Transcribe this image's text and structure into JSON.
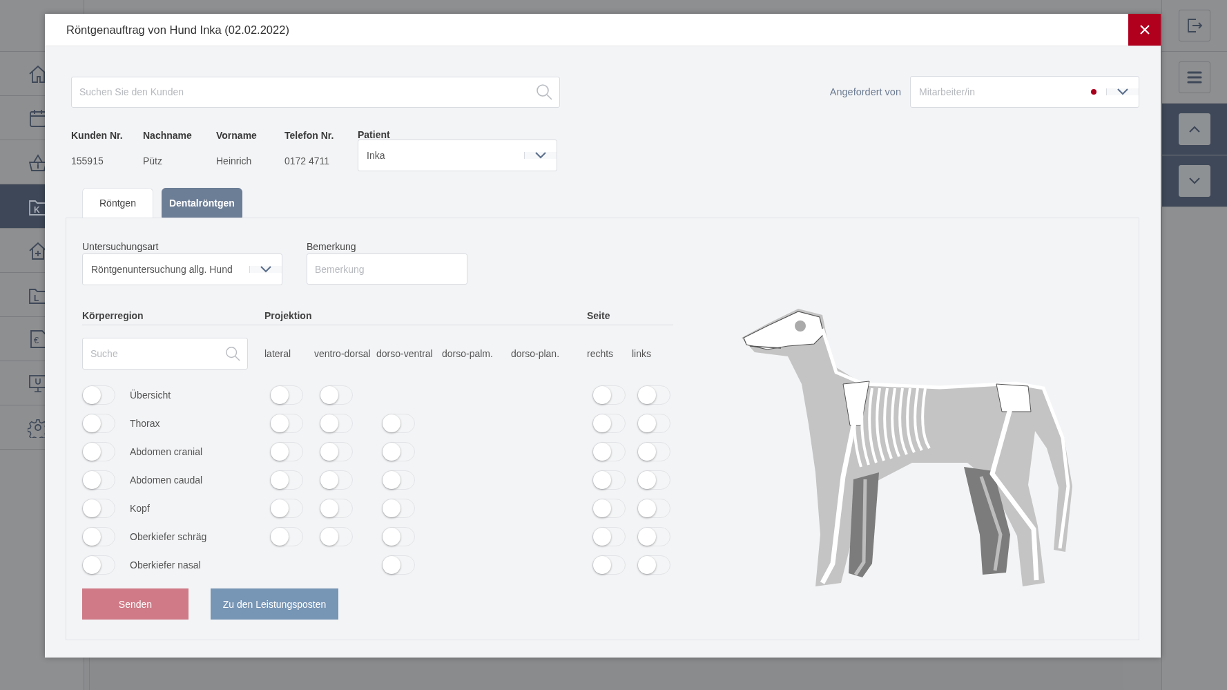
{
  "sidebar": {
    "items": [
      {
        "kind": "home",
        "selected": false
      },
      {
        "kind": "calendar",
        "selected": false
      },
      {
        "kind": "basket",
        "selected": false
      },
      {
        "kind": "folder",
        "letter": "K",
        "selected": true
      },
      {
        "kind": "house-plus",
        "selected": false
      },
      {
        "kind": "folder",
        "letter": "L",
        "selected": false
      },
      {
        "kind": "document",
        "letter": "€",
        "selected": false
      },
      {
        "kind": "monitor",
        "selected": false
      },
      {
        "kind": "gear",
        "selected": false
      }
    ]
  },
  "dialog": {
    "title": "Röntgenauftrag von Hund Inka (02.02.2022)",
    "customer_search": {
      "placeholder": "Suchen Sie den Kunden"
    },
    "requested_by": {
      "label": "Angefordert von",
      "placeholder": "Mitarbeiter/in",
      "required": true
    },
    "customer": [
      {
        "label": "Kunden Nr.",
        "value": "155915"
      },
      {
        "label": "Nachname",
        "value": "Pütz"
      },
      {
        "label": "Vorname",
        "value": "Heinrich"
      },
      {
        "label": "Telefon Nr.",
        "value": "0172 4711"
      }
    ],
    "patient": {
      "label": "Patient",
      "value": "Inka"
    },
    "tabs": [
      {
        "label": "Röntgen",
        "selected": true
      },
      {
        "label": "Dentalröntgen",
        "selected": false
      }
    ],
    "exam_type": {
      "label": "Untersuchungsart",
      "value": "Röntgenuntersuchung allg. Hund"
    },
    "remark": {
      "label": "Bemerkung",
      "placeholder": "Bemerkung"
    },
    "body_regions": {
      "region_header": "Körperregion",
      "projection_header": "Projektion",
      "side_header": "Seite",
      "search_placeholder": "Suche",
      "columns": [
        "lateral",
        "ventro-dorsal",
        "dorso-ventral",
        "dorso-palm.",
        "dorso-plan.",
        "rechts",
        "links"
      ],
      "rows": [
        {
          "label": "Übersicht",
          "on": false,
          "toggles": [
            {
              "kind": "switch",
              "on": false
            },
            {
              "kind": "switch",
              "on": false
            },
            {
              "kind": "empty"
            },
            {
              "kind": "empty"
            },
            {
              "kind": "empty"
            },
            {
              "kind": "switch",
              "on": false
            },
            {
              "kind": "switch",
              "on": false
            }
          ]
        },
        {
          "label": "Thorax",
          "on": false,
          "toggles": [
            {
              "kind": "switch",
              "on": false
            },
            {
              "kind": "switch",
              "on": false
            },
            {
              "kind": "switch",
              "on": false
            },
            {
              "kind": "empty"
            },
            {
              "kind": "empty"
            },
            {
              "kind": "switch",
              "on": false
            },
            {
              "kind": "switch",
              "on": false
            }
          ]
        },
        {
          "label": "Abdomen cranial",
          "on": false,
          "toggles": [
            {
              "kind": "switch",
              "on": false
            },
            {
              "kind": "switch",
              "on": false
            },
            {
              "kind": "switch",
              "on": false
            },
            {
              "kind": "empty"
            },
            {
              "kind": "empty"
            },
            {
              "kind": "switch",
              "on": false
            },
            {
              "kind": "switch",
              "on": false
            }
          ]
        },
        {
          "label": "Abdomen caudal",
          "on": false,
          "toggles": [
            {
              "kind": "switch",
              "on": false
            },
            {
              "kind": "switch",
              "on": false
            },
            {
              "kind": "switch",
              "on": false
            },
            {
              "kind": "empty"
            },
            {
              "kind": "empty"
            },
            {
              "kind": "switch",
              "on": false
            },
            {
              "kind": "switch",
              "on": false
            }
          ]
        },
        {
          "label": "Kopf",
          "on": false,
          "toggles": [
            {
              "kind": "switch",
              "on": false
            },
            {
              "kind": "switch",
              "on": false
            },
            {
              "kind": "switch",
              "on": false
            },
            {
              "kind": "empty"
            },
            {
              "kind": "empty"
            },
            {
              "kind": "switch",
              "on": false
            },
            {
              "kind": "switch",
              "on": false
            }
          ]
        },
        {
          "label": "Oberkiefer schräg",
          "on": false,
          "toggles": [
            {
              "kind": "switch",
              "on": false
            },
            {
              "kind": "switch",
              "on": false
            },
            {
              "kind": "switch",
              "on": false
            },
            {
              "kind": "empty"
            },
            {
              "kind": "empty"
            },
            {
              "kind": "switch",
              "on": false
            },
            {
              "kind": "switch",
              "on": false
            }
          ]
        },
        {
          "label": "Oberkiefer nasal",
          "on": false,
          "toggles": [
            {
              "kind": "empty"
            },
            {
              "kind": "empty"
            },
            {
              "kind": "switch",
              "on": false
            },
            {
              "kind": "empty"
            },
            {
              "kind": "empty"
            },
            {
              "kind": "switch",
              "on": false
            },
            {
              "kind": "switch",
              "on": false
            }
          ]
        }
      ]
    },
    "buttons": [
      {
        "label": "Senden",
        "kind": "primary"
      },
      {
        "label": "Zu den Leistungsposten",
        "kind": "secondary"
      }
    ]
  }
}
